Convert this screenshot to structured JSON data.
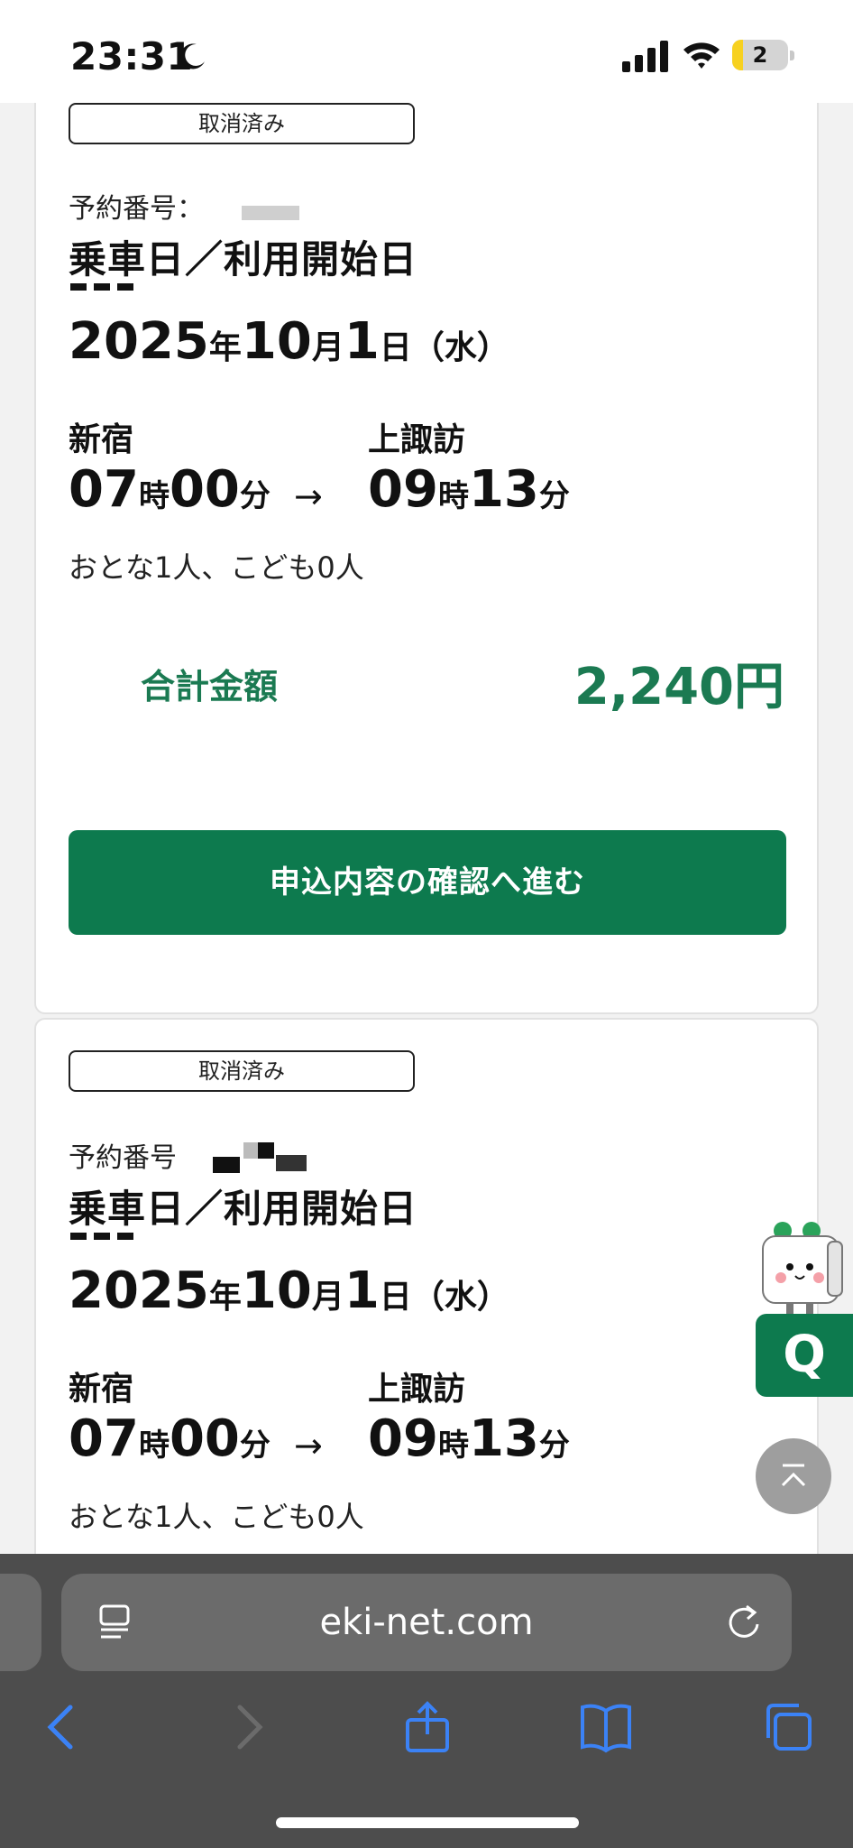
{
  "status_bar": {
    "time": "23:31",
    "battery_level": "2"
  },
  "reservations": [
    {
      "status_badge": "取消済み",
      "reservation_label": "予約番号：",
      "date_heading": "乗車日／利用開始日",
      "date_year": "2025",
      "date_year_unit": "年",
      "date_month": "10",
      "date_month_unit": "月",
      "date_day": "1",
      "date_day_unit": "日",
      "date_weekday": "（水）",
      "from_station": "新宿",
      "to_station": "上諏訪",
      "dep_hour": "07",
      "dep_hour_unit": "時",
      "dep_min": "00",
      "dep_min_unit": "分",
      "arrow": "→",
      "arr_hour": "09",
      "arr_hour_unit": "時",
      "arr_min": "13",
      "arr_min_unit": "分",
      "passengers": "おとな1人、こども0人",
      "total_label": "合計金額",
      "total_value": "2,240円",
      "cta_label": "申込内容の確認へ進む"
    },
    {
      "status_badge": "取消済み",
      "reservation_label": "予約番号",
      "date_heading": "乗車日／利用開始日",
      "date_year": "2025",
      "date_year_unit": "年",
      "date_month": "10",
      "date_month_unit": "月",
      "date_day": "1",
      "date_day_unit": "日",
      "date_weekday": "（水）",
      "from_station": "新宿",
      "to_station": "上諏訪",
      "dep_hour": "07",
      "dep_hour_unit": "時",
      "dep_min": "00",
      "dep_min_unit": "分",
      "arrow": "→",
      "arr_hour": "09",
      "arr_hour_unit": "時",
      "arr_min": "13",
      "arr_min_unit": "分",
      "passengers": "おとな1人、こども0人"
    }
  ],
  "floating": {
    "help_button_label": "Q"
  },
  "browser": {
    "url": "eki-net.com",
    "icons": [
      "reader-icon",
      "reload-icon",
      "back-icon",
      "forward-icon",
      "share-icon",
      "bookmarks-icon",
      "tabs-icon"
    ]
  },
  "colors": {
    "accent": "#0d7a4e",
    "total_text": "#1b7a52",
    "browser_bar": "#4d4d4d",
    "browser_tint": "#3b82f6"
  }
}
